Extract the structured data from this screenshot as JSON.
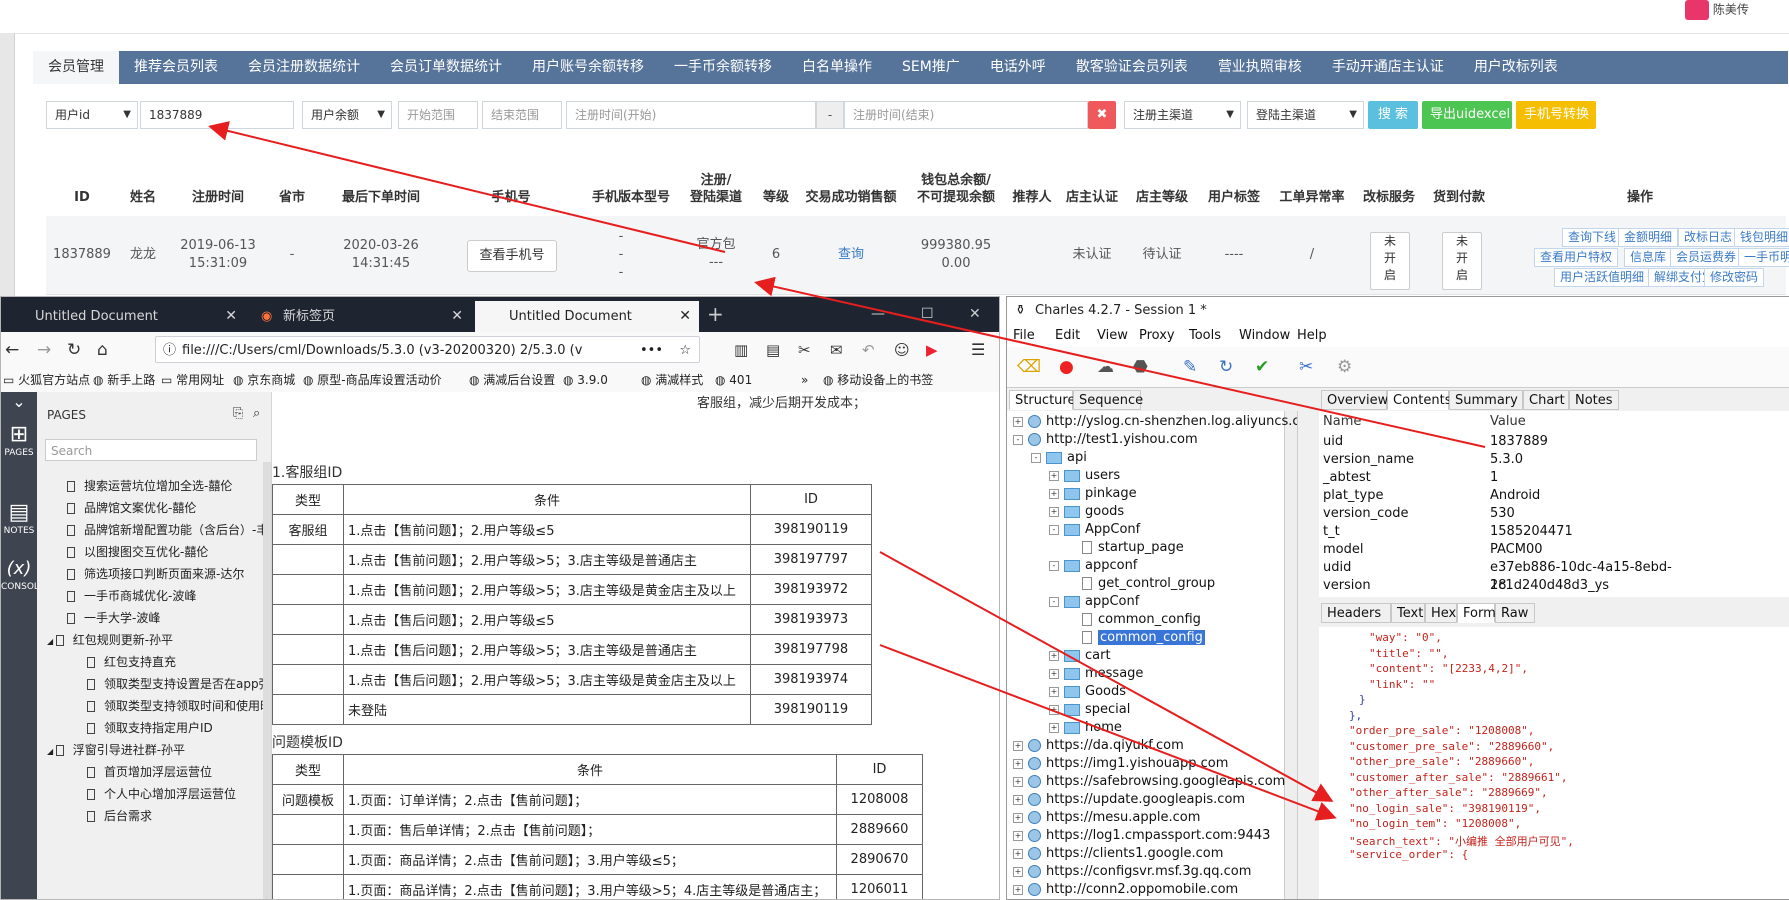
{
  "admin": {
    "user_name": "陈美传",
    "tabs": [
      "会员管理",
      "推荐会员列表",
      "会员注册数据统计",
      "会员订单数据统计",
      "用户账号余额转移",
      "一手币余额转移",
      "白名单操作",
      "SEM推广",
      "电话外呼",
      "散客验证会员列表",
      "营业执照审核",
      "手动开通店主认证",
      "用户改标列表"
    ],
    "filters": {
      "type_select": "用户id",
      "uid_value": "1837889",
      "balance_select": "用户余额",
      "start_range_ph": "开始范围",
      "end_range_ph": "结束范围",
      "reg_start_ph": "注册时间(开始)",
      "dash": "-",
      "reg_end_ph": "注册时间(结束)",
      "clear": "✖",
      "reg_channel": "注册主渠道",
      "login_channel": "登陆主渠道",
      "search_btn": "搜 索",
      "export_btn": "导出uidexcel",
      "phone_transfer_btn": "手机号转换"
    },
    "headers": {
      "id": "ID",
      "name": "姓名",
      "reg_time": "注册时间",
      "province": "省市",
      "last_order": "最后下单时间",
      "phone": "手机号",
      "app_version": "手机版本型号",
      "channel_1": "注册/",
      "channel_2": "登陆渠道",
      "level": "等级",
      "sales": "交易成功销售额",
      "wallet_1": "钱包总余额/",
      "wallet_2": "不可提现余额",
      "referrer": "推荐人",
      "shop_auth": "店主认证",
      "shop_level": "店主等级",
      "user_tag": "用户标签",
      "order_exception": "工单异常率",
      "mark_service": "改标服务",
      "cod": "货到付款",
      "ops": "操作"
    },
    "row": {
      "id": "1837889",
      "name": "龙龙",
      "reg_date": "2019-06-13",
      "reg_time": "15:31:09",
      "province": "-",
      "last_date": "2020-03-26",
      "last_time": "14:31:45",
      "phone_btn": "查看手机号",
      "app_1": "-",
      "app_2": "-",
      "app_3": "-",
      "channel_1": "官方包",
      "channel_2": "---",
      "level": "6",
      "sales": "查询",
      "wallet_1": "999380.95",
      "wallet_2": "0.00",
      "shop_auth": "未认证",
      "shop_level": "待认证",
      "user_tag": "----",
      "order_exception": "/",
      "mark_service": "未\n开\n启",
      "cod": "未\n开\n启",
      "ops": [
        "查询下线",
        "金额明细",
        "改标日志",
        "钱包明细",
        "查看用户特权",
        "信息库",
        "会员运费券",
        "一手币明细",
        "用户活跃值明细",
        "解绑支付宝",
        "修改密码"
      ]
    }
  },
  "firefox": {
    "tabs": [
      "Untitled Document",
      "新标签页",
      "Untitled Document"
    ],
    "url": "file:///C:/Users/cml/Downloads/5.3.0  (v3-20200320)  2/5.3.0  (v",
    "bookmarks": [
      "火狐官方站点",
      "新手上路",
      "常用网址",
      "京东商城",
      "原型-商品库设置活动价",
      "满减后台设置",
      "3.9.0",
      "满减样式",
      "401",
      "移动设备上的书签"
    ],
    "sidebar_labels": [
      "PAGES",
      "NOTES",
      "CONSOLE"
    ],
    "pages_title": "PAGES",
    "search_ph": "Search",
    "pages": [
      {
        "label": "搜索运营坑位增加全选-囍伦",
        "level": 1
      },
      {
        "label": "品牌馆文案优化-囍伦",
        "level": 1
      },
      {
        "label": "品牌馆新增配置功能（含后台）-丰",
        "level": 1
      },
      {
        "label": "以图搜图交互优化-囍伦",
        "level": 1
      },
      {
        "label": "筛选项接口判断页面来源-达尔",
        "level": 1
      },
      {
        "label": "一手币商城优化-波峰",
        "level": 1
      },
      {
        "label": "一手大学-波峰",
        "level": 1
      },
      {
        "label": "红包规则更新-孙平",
        "level": 0
      },
      {
        "label": "红包支持直充",
        "level": 2
      },
      {
        "label": "领取类型支持设置是否在app弹",
        "level": 2
      },
      {
        "label": "领取类型支持领取时间和使用时",
        "level": 2
      },
      {
        "label": "领取支持指定用户ID",
        "level": 2
      },
      {
        "label": "浮窗引导进社群-孙平",
        "level": 0
      },
      {
        "label": "首页增加浮层运营位",
        "level": 2
      },
      {
        "label": "个人中心增加浮层运营位",
        "level": 2
      },
      {
        "label": "后台需求",
        "level": 2
      }
    ],
    "doc": {
      "top_text": "客服组，减少后期开发成本；",
      "sec1": "1.客服组ID",
      "t1_head": [
        "类型",
        "条件",
        "ID"
      ],
      "t1_rows": [
        [
          "客服组",
          "1.点击【售前问题】；2.用户等级≤5",
          "398190119"
        ],
        [
          "",
          "1.点击【售前问题】；2.用户等级>5；3.店主等级是普通店主",
          "398197797"
        ],
        [
          "",
          "1.点击【售前问题】；2.用户等级>5；3.店主等级是黄金店主及以上",
          "398193972"
        ],
        [
          "",
          "1.点击【售后问题】；2.用户等级≤5",
          "398193973"
        ],
        [
          "",
          "1.点击【售后问题】；2.用户等级>5；3.店主等级是普通店主",
          "398197798"
        ],
        [
          "",
          "1.点击【售后问题】；2.用户等级>5；3.店主等级是黄金店主及以上",
          "398193974"
        ],
        [
          "",
          "未登陆",
          "398190119"
        ]
      ],
      "sec2": "问题模板ID",
      "t2_head": [
        "类型",
        "条件",
        "ID"
      ],
      "t2_rows": [
        [
          "问题模板",
          "1.页面：订单详情；2.点击【售前问题】；",
          "1208008"
        ],
        [
          "",
          "1.页面：售后单详情；2.点击【售前问题】；",
          "2889660"
        ],
        [
          "",
          "1.页面：商品详情；2.点击【售前问题】；3.用户等级≤5；",
          "2890670"
        ],
        [
          "",
          "1.页面：商品详情；2.点击【售前问题】；3.用户等级>5；4.店主等级是普通店主；",
          "1206011"
        ]
      ]
    }
  },
  "charles": {
    "title": "Charles 4.2.7 - Session 1 *",
    "menu": [
      "File",
      "Edit",
      "View",
      "Proxy",
      "Tools",
      "Window",
      "Help"
    ],
    "left_tabs": [
      "Structure",
      "Sequence"
    ],
    "right_tabs": [
      "Overview",
      "Contents",
      "Summary",
      "Chart",
      "Notes"
    ],
    "body_tabs": [
      "Headers",
      "Text",
      "Hex",
      "Form",
      "Raw"
    ],
    "tree": [
      {
        "label": "http://yslog.cn-shenzhen.log.aliyuncs.con",
        "kind": "globe",
        "indent": 0,
        "exp": "+"
      },
      {
        "label": "http://test1.yishou.com",
        "kind": "globe",
        "indent": 0,
        "exp": "-"
      },
      {
        "label": "api",
        "kind": "folder",
        "indent": 1,
        "exp": "-"
      },
      {
        "label": "users",
        "kind": "folder",
        "indent": 2,
        "exp": "+"
      },
      {
        "label": "pinkage",
        "kind": "folder",
        "indent": 2,
        "exp": "+"
      },
      {
        "label": "goods",
        "kind": "folder",
        "indent": 2,
        "exp": "+"
      },
      {
        "label": "AppConf",
        "kind": "folder",
        "indent": 2,
        "exp": "-"
      },
      {
        "label": "startup_page",
        "kind": "file",
        "indent": 3,
        "exp": ""
      },
      {
        "label": "appconf",
        "kind": "folder",
        "indent": 2,
        "exp": "-"
      },
      {
        "label": "get_control_group",
        "kind": "file",
        "indent": 3,
        "exp": ""
      },
      {
        "label": "appConf",
        "kind": "folder",
        "indent": 2,
        "exp": "-"
      },
      {
        "label": "common_config",
        "kind": "file",
        "indent": 3,
        "exp": ""
      },
      {
        "label": "common_config",
        "kind": "file",
        "indent": 3,
        "exp": "",
        "selected": true
      },
      {
        "label": "cart",
        "kind": "folder",
        "indent": 2,
        "exp": "+"
      },
      {
        "label": "message",
        "kind": "folder",
        "indent": 2,
        "exp": "+"
      },
      {
        "label": "Goods",
        "kind": "folder",
        "indent": 2,
        "exp": "+"
      },
      {
        "label": "special",
        "kind": "folder",
        "indent": 2,
        "exp": "+"
      },
      {
        "label": "home",
        "kind": "folder",
        "indent": 2,
        "exp": "+"
      },
      {
        "label": "https://da.qiyukf.com",
        "kind": "lock",
        "indent": 0,
        "exp": "+"
      },
      {
        "label": "https://img1.yishouapp.com",
        "kind": "lock",
        "indent": 0,
        "exp": "+"
      },
      {
        "label": "https://safebrowsing.googleapis.com",
        "kind": "lock",
        "indent": 0,
        "exp": "+"
      },
      {
        "label": "https://update.googleapis.com",
        "kind": "lock",
        "indent": 0,
        "exp": "+"
      },
      {
        "label": "https://mesu.apple.com",
        "kind": "lock",
        "indent": 0,
        "exp": "+"
      },
      {
        "label": "https://log1.cmpassport.com:9443",
        "kind": "lock",
        "indent": 0,
        "exp": "+"
      },
      {
        "label": "https://clients1.google.com",
        "kind": "lock",
        "indent": 0,
        "exp": "+"
      },
      {
        "label": "https://configsvr.msf.3g.qq.com",
        "kind": "lock",
        "indent": 0,
        "exp": "+"
      },
      {
        "label": "http://conn2.oppomobile.com",
        "kind": "globe",
        "indent": 0,
        "exp": "+"
      }
    ],
    "kv_head": [
      "Name",
      "Value"
    ],
    "kv": [
      [
        "uid",
        "1837889"
      ],
      [
        "version_name",
        "5.3.0"
      ],
      [
        "_abtest",
        "1"
      ],
      [
        "plat_type",
        "Android"
      ],
      [
        "version_code",
        "530"
      ],
      [
        "t_t",
        "1585204471"
      ],
      [
        "model",
        "PACM00"
      ],
      [
        "udid",
        "e37eb886-10dc-4a15-8ebd-1c1d240d48d3_ys"
      ],
      [
        "version",
        "28"
      ]
    ],
    "code": [
      "\"way\": \"0\",",
      "\"title\": \"\",",
      "\"content\": \"[2233,4,2]\",",
      "\"link\": \"\"",
      "}",
      "},",
      "\"order_pre_sale\": \"1208008\",",
      "\"customer_pre_sale\": \"2889660\",",
      "\"other_pre_sale\": \"2889660\",",
      "\"customer_after_sale\": \"2889661\",",
      "\"other_after_sale\": \"2889669\",",
      "\"no_login_sale\": \"398190119\",",
      "\"no_login_tem\": \"1208008\",",
      "\"search_text\": \"小编推 全部用户可见\",",
      "\"service_order\": {"
    ]
  }
}
